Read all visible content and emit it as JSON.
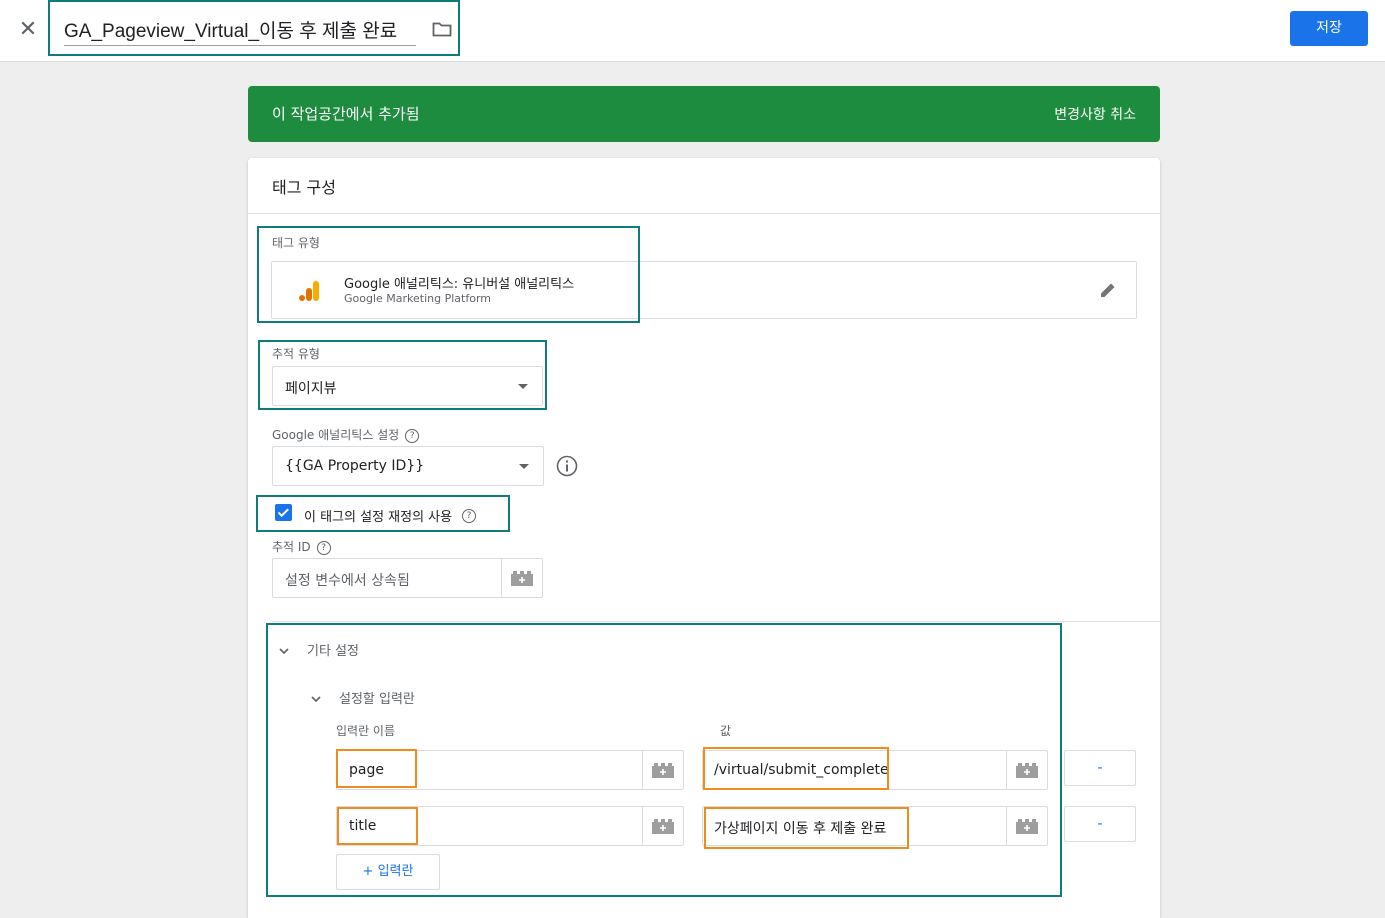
{
  "header": {
    "close_icon": "close-icon",
    "tag_name": "GA_Pageview_Virtual_이동 후 제출 완료",
    "folder_icon": "folder-icon",
    "save_label": "저장"
  },
  "banner": {
    "text": "이 작업공간에서 추가됨",
    "cancel_label": "변경사항 취소",
    "color": "#1e8c3f"
  },
  "card": {
    "title": "태그 구성",
    "tag_type": {
      "label": "태그 유형",
      "name": "Google 애널리틱스: 유니버설 애널리틱스",
      "platform": "Google Marketing Platform",
      "edit_icon": "pencil-icon"
    },
    "track_type": {
      "label": "추적 유형",
      "value": "페이지뷰"
    },
    "ga_settings": {
      "label": "Google 애널리틱스 설정",
      "value": "{{GA Property ID}}",
      "info_icon": "info-icon"
    },
    "override": {
      "label": "이 태그의 설정 재정의 사용",
      "checked": true
    },
    "tracking_id": {
      "label": "추적 ID",
      "placeholder": "설정 변수에서 상속됨"
    },
    "more_settings": {
      "label": "기타 설정",
      "fields_to_set": {
        "label": "설정할 입력란",
        "col_name": "입력란 이름",
        "col_value": "값",
        "rows": [
          {
            "name": "page",
            "value": "/virtual/submit_complete",
            "remove_label": "-"
          },
          {
            "name": "title",
            "value": "가상페이지 이동 후 제출 완료",
            "remove_label": "-"
          }
        ],
        "add_label": "+ 입력란"
      }
    }
  },
  "colors": {
    "accent": "#1a73e8",
    "highlight_teal": "#0e7c7b",
    "highlight_orange": "#f08c1e"
  }
}
